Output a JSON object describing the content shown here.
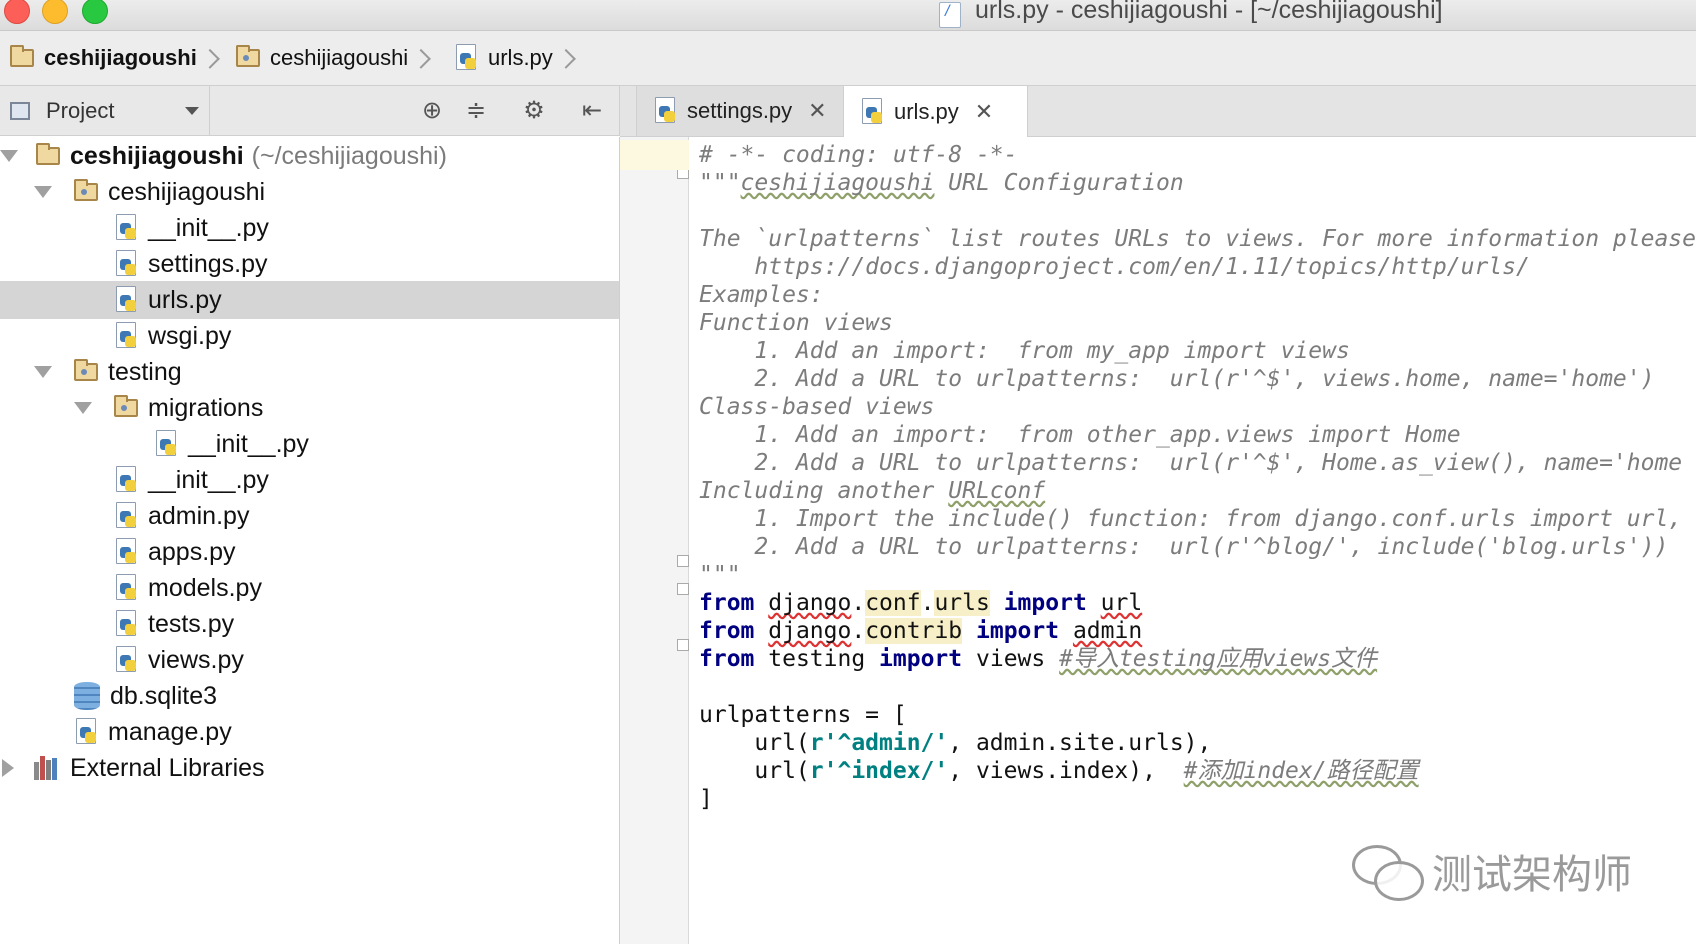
{
  "window": {
    "title": "urls.py - ceshijiagoushi - [~/ceshijiagoushi]"
  },
  "breadcrumbs": [
    "ceshijiagoushi",
    "ceshijiagoushi",
    "urls.py"
  ],
  "project_panel": {
    "view_label": "Project",
    "tree": [
      {
        "label": "ceshijiagoushi",
        "hint": "(~/ceshijiagoushi)"
      },
      {
        "label": "ceshijiagoushi"
      },
      {
        "label": "__init__.py"
      },
      {
        "label": "settings.py"
      },
      {
        "label": "urls.py"
      },
      {
        "label": "wsgi.py"
      },
      {
        "label": "testing"
      },
      {
        "label": "migrations"
      },
      {
        "label": "__init__.py"
      },
      {
        "label": "__init__.py"
      },
      {
        "label": "admin.py"
      },
      {
        "label": "apps.py"
      },
      {
        "label": "models.py"
      },
      {
        "label": "tests.py"
      },
      {
        "label": "views.py"
      },
      {
        "label": "db.sqlite3"
      },
      {
        "label": "manage.py"
      },
      {
        "label": "External Libraries"
      }
    ]
  },
  "editor": {
    "tabs": [
      {
        "label": "settings.py",
        "active": false
      },
      {
        "label": "urls.py",
        "active": true
      }
    ],
    "code": {
      "l1": "# -*- coding: utf-8 -*-",
      "l2a": "\"\"\"",
      "l2b": "ceshijiagoushi",
      "l2c": " URL Configuration",
      "l4": "The `urlpatterns` list routes URLs to views. For more information please",
      "l5": "    https://docs.djangoproject.com/en/1.11/topics/http/urls/",
      "l6": "Examples:",
      "l7": "Function views",
      "l8": "    1. Add an import:  from my_app import views",
      "l9": "    2. Add a URL to urlpatterns:  url(r'^$', views.home, name='home')",
      "l10": "Class-based views",
      "l11": "    1. Add an import:  from other_app.views import Home",
      "l12": "    2. Add a URL to urlpatterns:  url(r'^$', Home.as_view(), name='home",
      "l13a": "Including another ",
      "l13b": "URLconf",
      "l14": "    1. Import the include() function: from django.conf.urls import url,",
      "l15": "    2. Add a URL to urlpatterns:  url(r'^blog/', include('blog.urls'))",
      "l16": "\"\"\"",
      "from": "from",
      "import": "import",
      "django": "django",
      "dot": ".",
      "conf": "conf",
      "urls": "urls",
      "url": "url",
      "contrib": "contrib",
      "admin": "admin",
      "testing": "testing",
      "views": "views",
      "c19": "#导入testing应用views文件",
      "l21": "urlpatterns = [",
      "indent": "    ",
      "url_open": "url(",
      "s22": "r'^admin/'",
      "r22": ", admin.site.urls),",
      "s23": "r'^index/'",
      "r23": ", views.index),  ",
      "c23": "#添加index/路径配置",
      "l24": "]"
    }
  },
  "watermark": {
    "text": "测试架构师"
  },
  "colors": {
    "keyword": "#000080",
    "string": "#008080",
    "comment": "#7c7c7c",
    "selection": "#d5d5d5"
  }
}
